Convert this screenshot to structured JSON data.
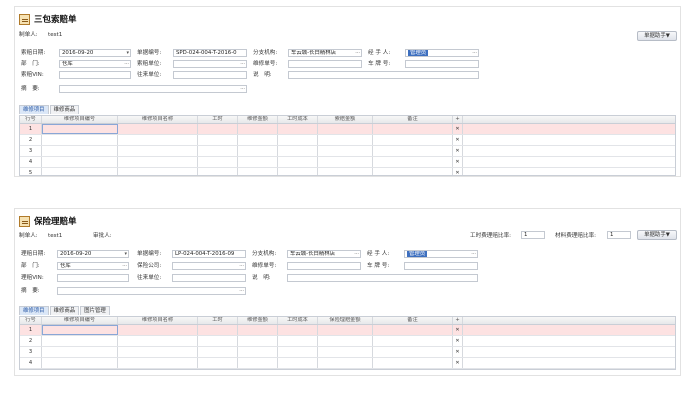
{
  "form1": {
    "title": "三包索赔单",
    "creator_label": "制单人:",
    "creator_value": "test1",
    "switch_button": "单据助手▼",
    "fields": {
      "date_label": "索赔日期:",
      "date_value": "2016-09-20",
      "doc_no_label": "单据编号:",
      "doc_no_value": "SPD-024-004-T-2016-0",
      "branch_label": "分支机构:",
      "branch_value": "车云城-长白精林店",
      "handler_label": "经 手 人:",
      "handler_value": "管理员",
      "dept_label": "部　门:",
      "dept_value": "仓库",
      "claim_unit_label": "索赔单位:",
      "claim_unit_value": "",
      "repair_no_label": "维修单号:",
      "repair_no_value": "",
      "plate_label": "车 牌 号:",
      "plate_value": "",
      "vin_label": "索赔VIN:",
      "vin_value": "",
      "contact_unit_label": "往来单位:",
      "contact_unit_value": "",
      "note_label": "说　明:",
      "note_value": "",
      "summary_label": "摘　要:",
      "summary_value": ""
    },
    "tabs": [
      "维修项目",
      "维修商品"
    ],
    "columns": [
      "行号",
      "维修项目编号",
      "维修项目名称",
      "工时",
      "维修金额",
      "工时成本",
      "索赔金额",
      "备注",
      "+"
    ],
    "rows": [
      "1",
      "2",
      "3",
      "4",
      "5"
    ]
  },
  "form2": {
    "title": "保险理赔单",
    "creator_label": "制单人:",
    "creator_value": "test1",
    "auditor_label": "审批人:",
    "labor_ratio_label": "工时费理赔比率:",
    "labor_ratio_value": "1",
    "material_ratio_label": "材料费理赔比率:",
    "material_ratio_value": "1",
    "switch_button": "单据助手▼",
    "fields": {
      "date_label": "理赔日期:",
      "date_value": "2016-09-20",
      "doc_no_label": "单据编号:",
      "doc_no_value": "LP-024-004-T-2016-09",
      "branch_label": "分支机构:",
      "branch_value": "车云城-长白精林店",
      "handler_label": "经 手 人:",
      "handler_value": "管理员",
      "dept_label": "部　门:",
      "dept_value": "仓库",
      "insurer_label": "保险公司:",
      "insurer_value": "",
      "repair_no_label": "维修单号:",
      "repair_no_value": "",
      "plate_label": "车 牌 号:",
      "plate_value": "",
      "vin_label": "理赔VIN:",
      "vin_value": "",
      "contact_unit_label": "往来单位:",
      "contact_unit_value": "",
      "note_label": "说　明:",
      "note_value": "",
      "summary_label": "摘　要:",
      "summary_value": ""
    },
    "tabs": [
      "维修项目",
      "维修商品",
      "图片管理"
    ],
    "columns": [
      "行号",
      "维修项目编号",
      "维修项目名称",
      "工时",
      "维修金额",
      "工时成本",
      "保险理赔金额",
      "备注",
      "+"
    ],
    "rows": [
      "1",
      "2",
      "3",
      "4"
    ]
  },
  "icons": {
    "title": "edit-document-icon",
    "lookup": "ellipsis-icon",
    "dropdown": "chevron-down-icon",
    "row_delete": "delete-row-icon"
  },
  "colors": {
    "selected_row": "#fde2e2",
    "active_tab": "#dbe7f7",
    "highlight": "#3d6fbf"
  }
}
